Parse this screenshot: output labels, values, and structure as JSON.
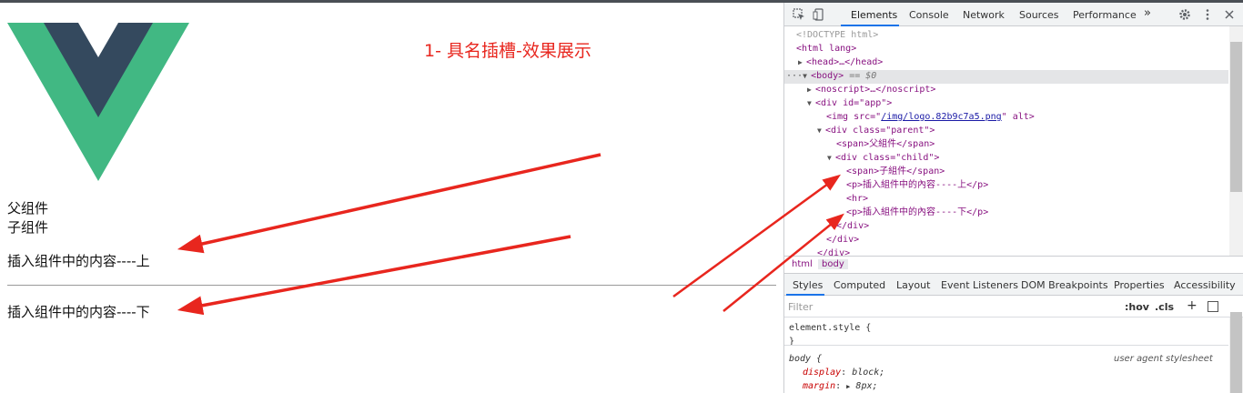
{
  "page": {
    "annotation_title": "1- 具名插槽-效果展示",
    "parent_label": "父组件",
    "child_label": "子组件",
    "slot_top": "插入组件中的内容----上",
    "slot_bottom": "插入组件中的内容----下"
  },
  "devtools": {
    "tabs": [
      "Elements",
      "Console",
      "Network",
      "Sources",
      "Performance"
    ],
    "active_tab": "Elements",
    "more_tabs": "»",
    "dom": {
      "doctype": "<!DOCTYPE html>",
      "html_open": "<html lang>",
      "head": "<head>…</head>",
      "body_open": "<body>",
      "body_sel": "== $0",
      "noscript": "<noscript>…</noscript>",
      "div_app": "<div id=\"app\">",
      "img_pre": "<img src=\"",
      "img_src": "/img/logo.82b9c7a5.png",
      "img_post": "\" alt>",
      "div_parent": "<div class=\"parent\">",
      "span_parent": "<span>父組件</span>",
      "div_child": "<div class=\"child\">",
      "span_child": "<span>子組件</span>",
      "p_top": "<p>插入組件中的內容----上</p>",
      "hr": "<hr>",
      "p_bottom": "<p>插入組件中的內容----下</p>",
      "div_close": "</div>"
    },
    "breadcrumbs": [
      "html",
      "body"
    ],
    "active_crumb": "body",
    "styles_tabs": [
      "Styles",
      "Computed",
      "Layout",
      "Event Listeners",
      "DOM Breakpoints",
      "Properties",
      "Accessibility"
    ],
    "active_styles_tab": "Styles",
    "filter_placeholder": "Filter",
    "hov_label": ":hov",
    "cls_label": ".cls",
    "plus_label": "+",
    "styles": {
      "element_style": "element.style {",
      "close_brace": "}",
      "body_rule": "body {",
      "origin": "user agent stylesheet",
      "display_prop": "display",
      "display_val": "block;",
      "margin_prop": "margin",
      "margin_val": "8px;"
    }
  },
  "colors": {
    "annotation_red": "#e8261e",
    "vue_green": "#41b883",
    "vue_dark": "#34495e",
    "devtools_blue": "#1a73e8"
  }
}
